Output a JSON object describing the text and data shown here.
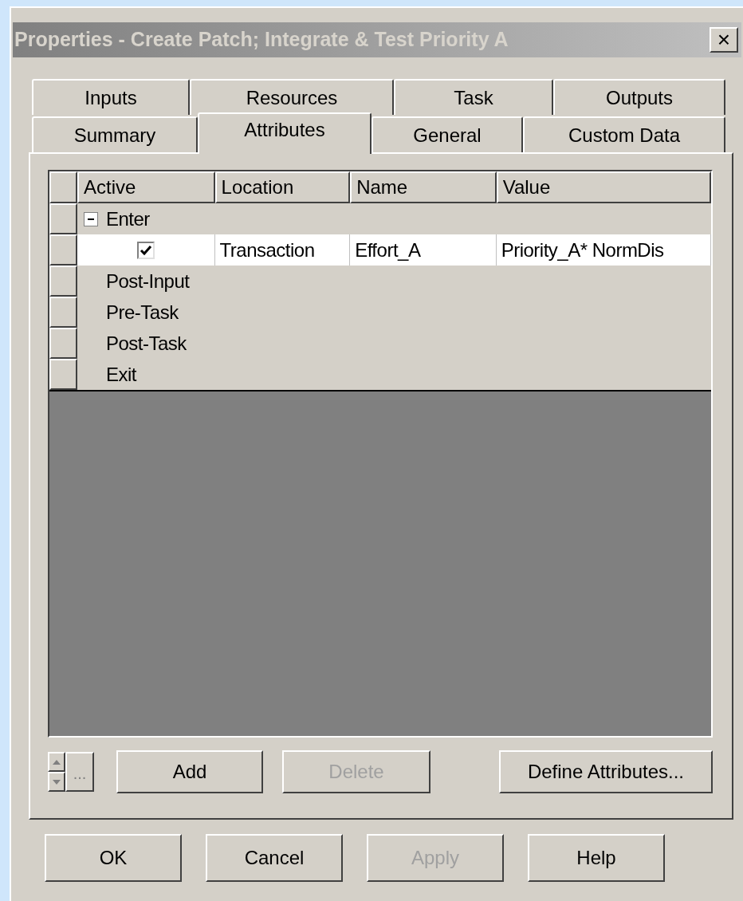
{
  "window": {
    "title": "Properties - Create Patch; Integrate & Test Priority A",
    "close": "×"
  },
  "tab_rows": [
    [
      {
        "label": "Inputs",
        "selected": false
      },
      {
        "label": "Resources",
        "selected": false
      },
      {
        "label": "Task",
        "selected": false
      },
      {
        "label": "Outputs",
        "selected": false
      }
    ],
    [
      {
        "label": "Summary",
        "selected": false
      },
      {
        "label": "Attributes",
        "selected": true
      },
      {
        "label": "General",
        "selected": false
      },
      {
        "label": "Custom Data",
        "selected": false
      }
    ]
  ],
  "table": {
    "columns": [
      "Active",
      "Location",
      "Name",
      "Value"
    ],
    "groups": [
      {
        "label": "Enter",
        "expanded": true,
        "children": [
          {
            "active": true,
            "selected": true,
            "location": "Transaction",
            "name": "Effort_A",
            "value": "Priority_A* NormDis"
          }
        ]
      },
      {
        "label": "Post-Input"
      },
      {
        "label": "Pre-Task"
      },
      {
        "label": "Post-Task"
      },
      {
        "label": "Exit"
      }
    ]
  },
  "panel_buttons": [
    {
      "label": "Add",
      "disabled": false
    },
    {
      "label": "Delete",
      "disabled": true
    },
    {
      "label": "Define Attributes...",
      "disabled": false
    }
  ],
  "more_button": "...",
  "dialog_buttons": [
    {
      "label": "OK",
      "disabled": false
    },
    {
      "label": "Cancel",
      "disabled": false
    },
    {
      "label": "Apply",
      "disabled": true
    },
    {
      "label": "Help",
      "disabled": false
    }
  ]
}
